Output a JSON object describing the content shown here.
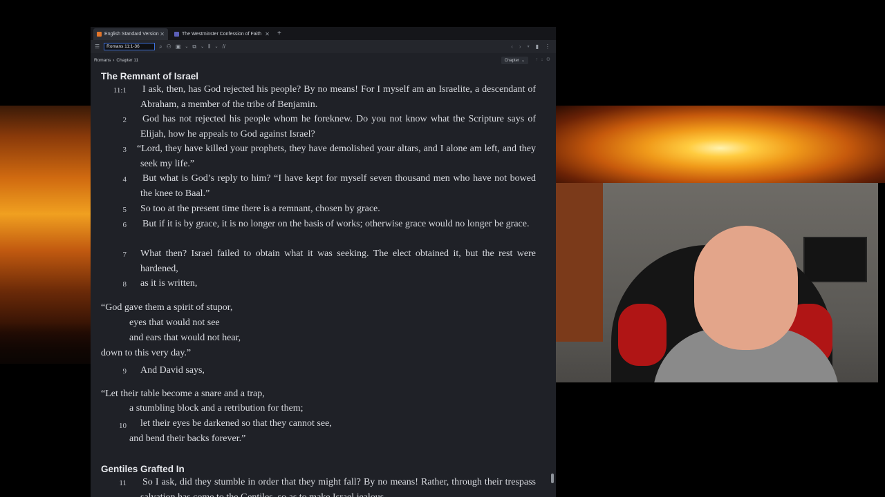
{
  "tabs": [
    {
      "label": "English Standard Version",
      "active": true,
      "icon": "book-orange-icon"
    },
    {
      "label": "The Westminster Confession of Faith",
      "active": false,
      "icon": "book-blue-icon"
    }
  ],
  "toolbar": {
    "reference": "Romans 11:1-36"
  },
  "breadcrumb": {
    "book": "Romans",
    "chapter": "Chapter 11",
    "chapter_select": "Chapter"
  },
  "sections": {
    "remnant": "The Remnant of Israel",
    "gentiles": "Gentiles Grafted In"
  },
  "verses": {
    "v1": {
      "num": "11:1",
      "text": "I ask, then, has God rejected his people? By no means! For I myself am an Israelite, a descendant of Abraham, a member of the tribe of Benjamin."
    },
    "v2": {
      "num": "2",
      "text": "God has not rejected his people whom he foreknew. Do you not know what the Scripture says of Elijah, how he appeals to God against Israel?"
    },
    "v3": {
      "num": "3",
      "text": "“Lord, they have killed your prophets, they have demolished your altars, and I alone am left, and they seek my life.”"
    },
    "v4": {
      "num": "4",
      "text": "But what is God’s reply to him? “I have kept for myself seven thousand men who have not bowed the knee to Baal.”"
    },
    "v5": {
      "num": "5",
      "text": "So too at the present time there is a remnant, chosen by grace."
    },
    "v6": {
      "num": "6",
      "text": "But if it is by grace, it is no longer on the basis of works; otherwise grace would no longer be grace."
    },
    "v7": {
      "num": "7",
      "text": "What then? Israel failed to obtain what it was seeking. The elect obtained it, but the rest were hardened,"
    },
    "v8": {
      "num": "8",
      "text": "as it is written,"
    },
    "v9": {
      "num": "9",
      "text": "And David says,"
    },
    "v10": {
      "num": "10"
    },
    "v11": {
      "num": "11",
      "text": "So I ask, did they stumble in order that they might fall? By no means! Rather, through their trespass salvation has come to the Gentiles, so as to make Israel jealous."
    }
  },
  "poems": {
    "p1": [
      "“God gave them a spirit of stupor,",
      "eyes that would not see",
      "and ears that would not hear,",
      "down to this very day.”"
    ],
    "p2": [
      "“Let their table become a snare and a trap,",
      "a stumbling block and a retribution for them;",
      "let their eyes be darkened so that they cannot see,",
      "and bend their backs forever.”"
    ]
  }
}
